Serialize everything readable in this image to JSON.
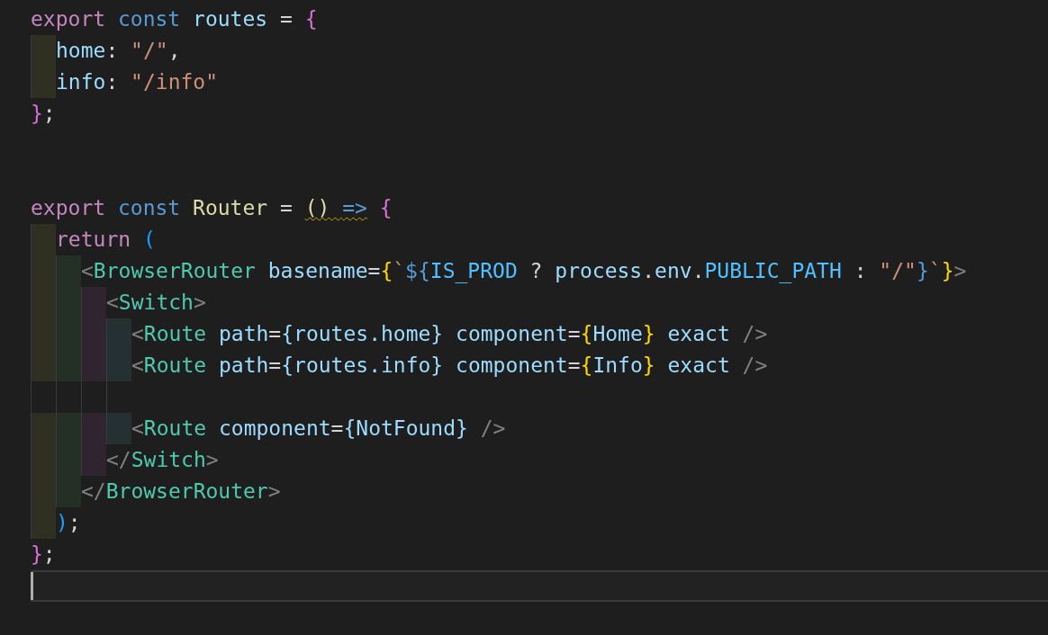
{
  "editor": {
    "lines": [
      {
        "current": false,
        "tokens": [
          {
            "kind": "keyword",
            "text": "export ",
            "warning": false
          },
          {
            "kind": "storage",
            "text": "const ",
            "warning": false
          },
          {
            "kind": "variable",
            "text": "routes ",
            "warning": false
          },
          {
            "kind": "text",
            "text": "= ",
            "warning": false
          },
          {
            "kind": "brace-pink",
            "text": "{",
            "warning": false
          }
        ],
        "children": [
          {
            "current": false,
            "tokens": [
              {
                "kind": "property",
                "text": "home",
                "warning": false
              },
              {
                "kind": "text",
                "text": ": ",
                "warning": false
              },
              {
                "kind": "string",
                "text": "\"/\"",
                "warning": false
              },
              {
                "kind": "text",
                "text": ",",
                "warning": false
              }
            ]
          },
          {
            "current": false,
            "tokens": [
              {
                "kind": "property",
                "text": "info",
                "warning": false
              },
              {
                "kind": "text",
                "text": ": ",
                "warning": false
              },
              {
                "kind": "string",
                "text": "\"/info\"",
                "warning": false
              }
            ]
          }
        ]
      },
      {
        "current": false,
        "tokens": [
          {
            "kind": "brace-pink",
            "text": "}",
            "warning": false
          },
          {
            "kind": "text",
            "text": ";",
            "warning": false
          }
        ]
      },
      {
        "current": false
      },
      {
        "current": false
      },
      {
        "current": false,
        "tokens": [
          {
            "kind": "keyword",
            "text": "export ",
            "warning": false
          },
          {
            "kind": "storage",
            "text": "const ",
            "warning": false
          },
          {
            "kind": "function",
            "text": "Router ",
            "warning": false
          },
          {
            "kind": "text",
            "text": "= ",
            "warning": false
          },
          {
            "kind": "paren",
            "text": "() ",
            "warning": true
          },
          {
            "kind": "storage",
            "text": "=>",
            "warning": true
          },
          {
            "kind": "brace-pink",
            "text": " {",
            "warning": false
          }
        ],
        "children": [
          {
            "current": false,
            "tokens": [
              {
                "kind": "keyword",
                "text": "return ",
                "warning": false
              },
              {
                "kind": "bracket-blue",
                "text": "(",
                "warning": false
              }
            ],
            "children": [
              {
                "current": false,
                "tokens": [
                  {
                    "kind": "tag-punct",
                    "text": "<",
                    "warning": false
                  },
                  {
                    "kind": "tag",
                    "text": "BrowserRouter ",
                    "warning": false
                  },
                  {
                    "kind": "attribute",
                    "text": "basename",
                    "warning": false
                  },
                  {
                    "kind": "text",
                    "text": "=",
                    "warning": false
                  },
                  {
                    "kind": "bracket-yellow",
                    "text": "{",
                    "warning": false
                  },
                  {
                    "kind": "string",
                    "text": "`",
                    "warning": false
                  },
                  {
                    "kind": "storage",
                    "text": "${",
                    "warning": false
                  },
                  {
                    "kind": "constant",
                    "text": "IS_PROD ",
                    "warning": false
                  },
                  {
                    "kind": "text",
                    "text": "? ",
                    "warning": false
                  },
                  {
                    "kind": "variable",
                    "text": "process",
                    "warning": false
                  },
                  {
                    "kind": "text",
                    "text": ".",
                    "warning": false
                  },
                  {
                    "kind": "variable",
                    "text": "env",
                    "warning": false
                  },
                  {
                    "kind": "text",
                    "text": ".",
                    "warning": false
                  },
                  {
                    "kind": "constant",
                    "text": "PUBLIC_PATH ",
                    "warning": false
                  },
                  {
                    "kind": "text",
                    "text": ": ",
                    "warning": false
                  },
                  {
                    "kind": "string",
                    "text": "\"/\"",
                    "warning": false
                  },
                  {
                    "kind": "storage",
                    "text": "}",
                    "warning": false
                  },
                  {
                    "kind": "string",
                    "text": "`",
                    "warning": false
                  },
                  {
                    "kind": "bracket-yellow",
                    "text": "}",
                    "warning": false
                  },
                  {
                    "kind": "tag-punct",
                    "text": ">",
                    "warning": false
                  }
                ],
                "children": [
                  {
                    "current": false,
                    "tokens": [
                      {
                        "kind": "tag-punct",
                        "text": "<",
                        "warning": false
                      },
                      {
                        "kind": "tag",
                        "text": "Switch",
                        "warning": false
                      },
                      {
                        "kind": "tag-punct",
                        "text": ">",
                        "warning": false
                      }
                    ],
                    "children": [
                      {
                        "current": false,
                        "tokens": [
                          {
                            "kind": "tag-punct",
                            "text": "<",
                            "warning": false
                          },
                          {
                            "kind": "tag",
                            "text": "Route ",
                            "warning": false
                          },
                          {
                            "kind": "attribute",
                            "text": "path",
                            "warning": false
                          },
                          {
                            "kind": "text",
                            "text": "=",
                            "warning": false
                          },
                          {
                            "kind": "variable",
                            "text": "{routes.home} ",
                            "warning": false
                          },
                          {
                            "kind": "attribute",
                            "text": "component",
                            "warning": false
                          },
                          {
                            "kind": "text",
                            "text": "=",
                            "warning": false
                          },
                          {
                            "kind": "bracket-yellow",
                            "text": "{",
                            "warning": false
                          },
                          {
                            "kind": "variable",
                            "text": "Home",
                            "warning": false
                          },
                          {
                            "kind": "bracket-yellow",
                            "text": "} ",
                            "warning": false
                          },
                          {
                            "kind": "attribute",
                            "text": "exact ",
                            "warning": false
                          },
                          {
                            "kind": "tag-punct",
                            "text": "/>",
                            "warning": false
                          }
                        ]
                      },
                      {
                        "current": false,
                        "tokens": [
                          {
                            "kind": "tag-punct",
                            "text": "<",
                            "warning": false
                          },
                          {
                            "kind": "tag",
                            "text": "Route ",
                            "warning": false
                          },
                          {
                            "kind": "attribute",
                            "text": "path",
                            "warning": false
                          },
                          {
                            "kind": "text",
                            "text": "=",
                            "warning": false
                          },
                          {
                            "kind": "variable",
                            "text": "{routes.info} ",
                            "warning": false
                          },
                          {
                            "kind": "attribute",
                            "text": "component",
                            "warning": false
                          },
                          {
                            "kind": "text",
                            "text": "=",
                            "warning": false
                          },
                          {
                            "kind": "bracket-yellow",
                            "text": "{",
                            "warning": false
                          },
                          {
                            "kind": "variable",
                            "text": "Info",
                            "warning": false
                          },
                          {
                            "kind": "bracket-yellow",
                            "text": "} ",
                            "warning": false
                          },
                          {
                            "kind": "attribute",
                            "text": "exact ",
                            "warning": false
                          },
                          {
                            "kind": "tag-punct",
                            "text": "/>",
                            "warning": false
                          }
                        ]
                      },
                      {
                        "current": false
                      },
                      {
                        "current": false,
                        "tokens": [
                          {
                            "kind": "tag-punct",
                            "text": "<",
                            "warning": false
                          },
                          {
                            "kind": "tag",
                            "text": "Route ",
                            "warning": false
                          },
                          {
                            "kind": "attribute",
                            "text": "component",
                            "warning": false
                          },
                          {
                            "kind": "text",
                            "text": "=",
                            "warning": false
                          },
                          {
                            "kind": "variable",
                            "text": "{NotFound} ",
                            "warning": false
                          },
                          {
                            "kind": "tag-punct",
                            "text": "/>",
                            "warning": false
                          }
                        ]
                      }
                    ]
                  },
                  {
                    "current": false,
                    "tokens": [
                      {
                        "kind": "tag-punct",
                        "text": "</",
                        "warning": false
                      },
                      {
                        "kind": "tag",
                        "text": "Switch",
                        "warning": false
                      },
                      {
                        "kind": "tag-punct",
                        "text": ">",
                        "warning": false
                      }
                    ]
                  }
                ]
              },
              {
                "current": false,
                "tokens": [
                  {
                    "kind": "tag-punct",
                    "text": "</",
                    "warning": false
                  },
                  {
                    "kind": "tag",
                    "text": "BrowserRouter",
                    "warning": false
                  },
                  {
                    "kind": "tag-punct",
                    "text": ">",
                    "warning": false
                  }
                ]
              }
            ]
          },
          {
            "current": false,
            "tokens": [
              {
                "kind": "bracket-blue",
                "text": ")",
                "warning": false
              },
              {
                "kind": "text",
                "text": ";",
                "warning": false
              }
            ]
          }
        ]
      },
      {
        "current": false,
        "tokens": [
          {
            "kind": "brace-pink",
            "text": "}",
            "warning": false
          },
          {
            "kind": "text",
            "text": ";",
            "warning": false
          }
        ]
      },
      {
        "current": true
      }
    ]
  }
}
